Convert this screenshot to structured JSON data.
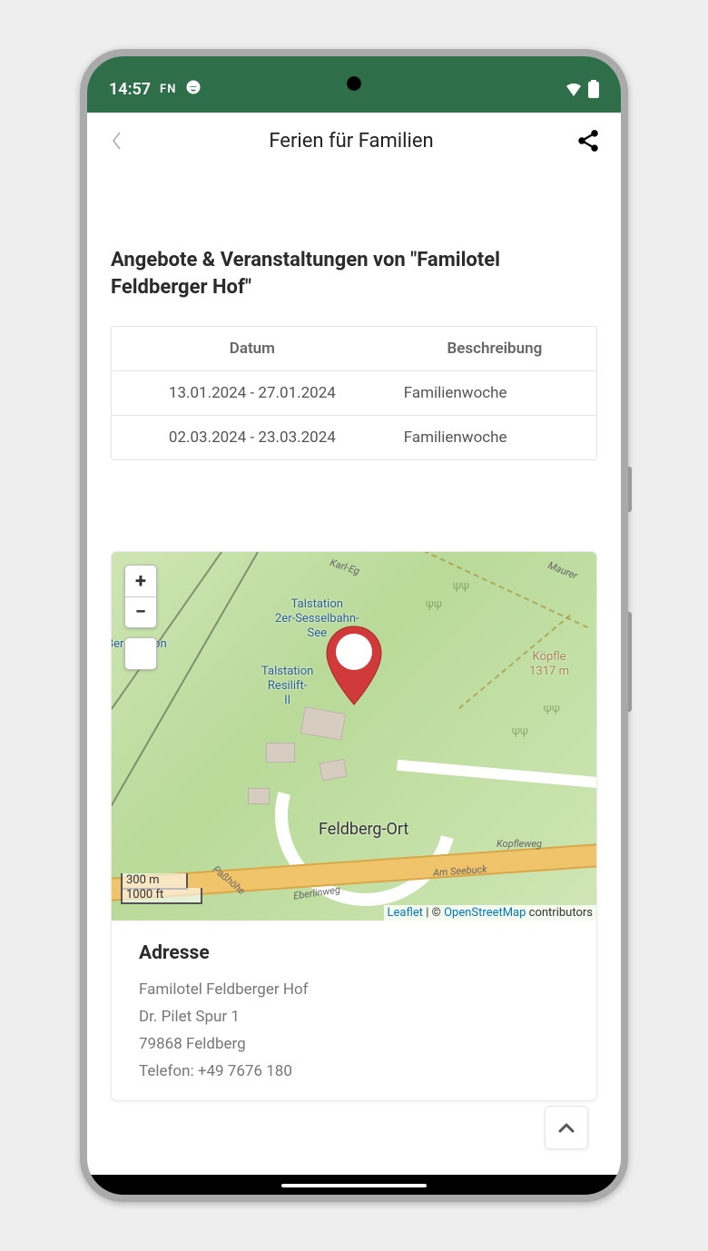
{
  "status": {
    "time": "14:57",
    "fn": "FN"
  },
  "header": {
    "title": "Ferien für Familien"
  },
  "section": {
    "title": "Angebote & Veranstaltungen von \"Familotel Feldberger Hof\""
  },
  "table": {
    "headers": {
      "date": "Datum",
      "desc": "Beschreibung"
    },
    "rows": [
      {
        "date": "13.01.2024 - 27.01.2024",
        "desc": "Familienwoche"
      },
      {
        "date": "02.03.2024 - 23.03.2024",
        "desc": "Familienwoche"
      }
    ]
  },
  "map": {
    "zoom_in": "+",
    "zoom_out": "−",
    "labels": {
      "talstation1": "Talstation\n2er-Sesselbahn-\nSee",
      "talstation2": "Talstation\nResilift-\nII",
      "bergstation": "Bergstation",
      "kopfle_name": "Köpfle",
      "kopfle_height": "1317 m",
      "feldberg": "Feldberg-Ort",
      "kopfleweg": "Kopfleweg",
      "seebuck": "Am Seebuck",
      "eberlinweg": "Eberlinweg",
      "passhohe": "Paßhöhe",
      "karleg": "Karl-Eg",
      "maurer": "Maurer"
    },
    "scale": {
      "metric": "300 m",
      "imperial": "1000 ft"
    },
    "attribution": {
      "leaflet": "Leaflet",
      "separator": " | © ",
      "osm": "OpenStreetMap",
      "suffix": " contributors"
    }
  },
  "address": {
    "heading": "Adresse",
    "name": "Familotel Feldberger Hof",
    "street": "Dr. Pilet Spur 1",
    "city": "79868 Feldberg",
    "phone": "Telefon: +49 7676 180"
  }
}
